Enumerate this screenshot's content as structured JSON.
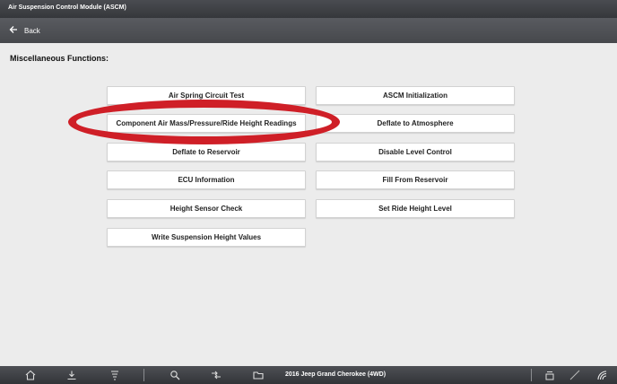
{
  "window": {
    "title": "Air Suspension Control Module (ASCM)"
  },
  "nav": {
    "back_label": "Back"
  },
  "main": {
    "section_title": "Miscellaneous Functions:",
    "buttons_left": [
      "Air Spring Circuit Test",
      "Component Air Mass/Pressure/Ride Height Readings",
      "Deflate to Reservoir",
      "ECU Information",
      "Height Sensor Check",
      "Write Suspension Height Values"
    ],
    "buttons_right": [
      "ASCM Initialization",
      "Deflate to Atmosphere",
      "Disable Level Control",
      "Fill From Reservoir",
      "Set Ride Height Level"
    ],
    "highlight_color": "#cf1f27"
  },
  "taskbar": {
    "vehicle": "2016 Jeep Grand Cherokee (4WD)",
    "icons": [
      "home-icon",
      "download-icon",
      "sort-icon",
      "magnify-icon",
      "connect-icon",
      "folder-icon",
      "vci-icon",
      "signal-icon",
      "logo-icon"
    ]
  }
}
